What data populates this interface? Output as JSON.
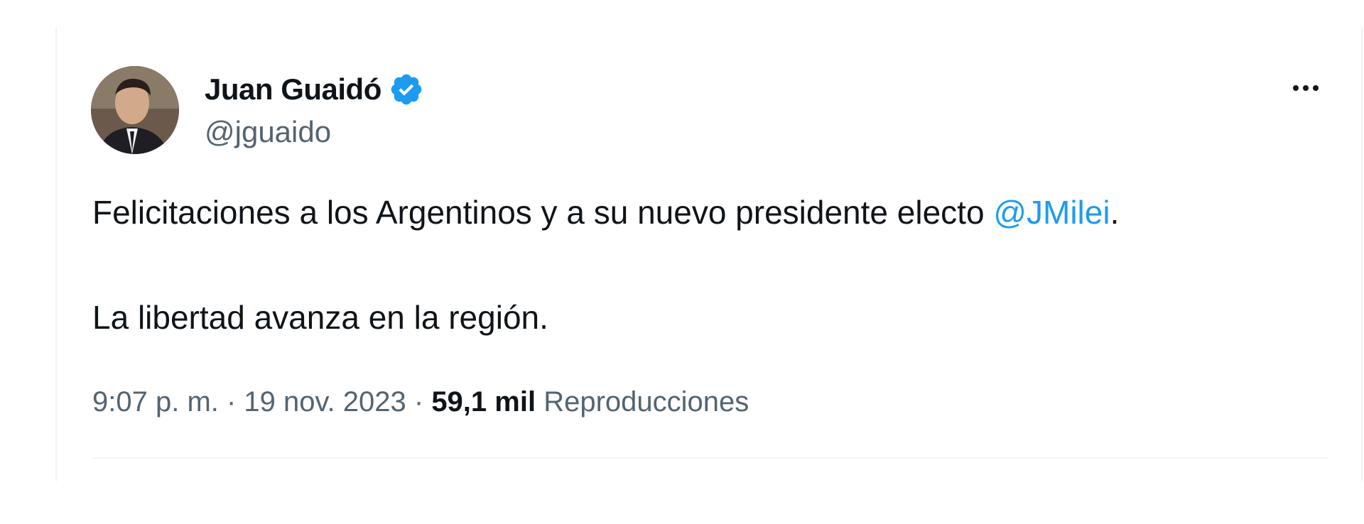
{
  "author": {
    "name": "Juan Guaidó",
    "handle": "@jguaido",
    "verified": true,
    "verified_color": "#1d9bf0"
  },
  "icons": {
    "verified": "verified-badge-icon",
    "more": "more-options-icon"
  },
  "tweet": {
    "line1_text": "Felicitaciones a los Argentinos y a su nuevo presidente electo ",
    "line1_mention": "@JMilei",
    "line1_end": ".",
    "line2_text": "La libertad avanza en la región."
  },
  "meta": {
    "time": "9:07 p. m.",
    "separator": " · ",
    "date": "19 nov. 2023",
    "views_count": "59,1 mil",
    "views_label": "Reproducciones"
  },
  "colors": {
    "link": "#1d9bf0",
    "text_primary": "#0f1419",
    "text_secondary": "#536471",
    "divider": "#eff3f4"
  }
}
